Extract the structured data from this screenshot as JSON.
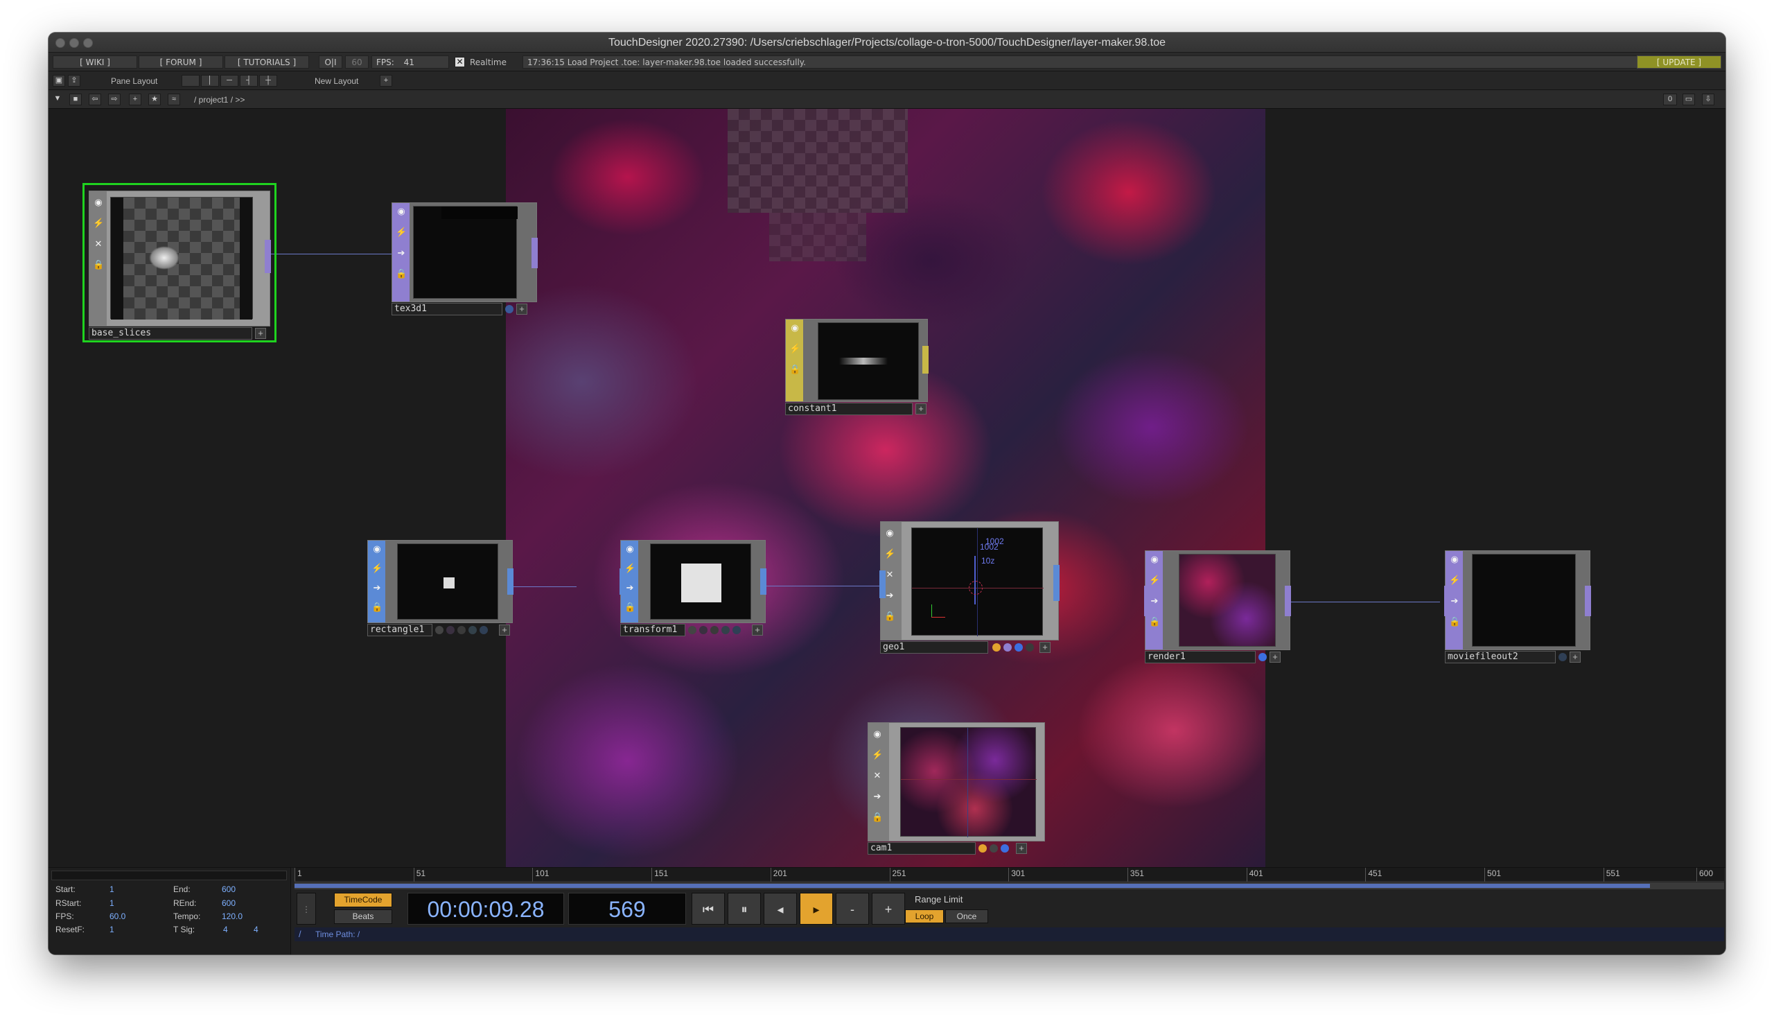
{
  "window": {
    "title": "TouchDesigner 2020.27390: /Users/criebschlager/Projects/collage-o-tron-5000/TouchDesigner/layer-maker.98.toe"
  },
  "menubar": {
    "wiki": "[ WIKI ]",
    "forum": "[ FORUM ]",
    "tutorials": "[ TUTORIALS ]",
    "oi": "O|I",
    "fps_cap": "60",
    "fps_label": "FPS:",
    "fps_value": "41",
    "realtime_label": "Realtime",
    "realtime_checked": true,
    "status_message": "17:36:15 Load Project .toe: layer-maker.98.toe loaded successfully.",
    "update": "[ UPDATE ]"
  },
  "pane_toolbar": {
    "pane_layout": "Pane Layout",
    "new_layout": "New Layout",
    "add": "+"
  },
  "path_bar": {
    "path": "/  project1  /  >>",
    "counter": "0"
  },
  "nodes": {
    "base_slices": {
      "name": "base_slices",
      "family": "COMP",
      "selected": true
    },
    "tex3d1": {
      "name": "tex3d1",
      "family": "TOP"
    },
    "constant1": {
      "name": "constant1",
      "family": "MAT"
    },
    "rectangle1": {
      "name": "rectangle1",
      "family": "SOP"
    },
    "transform1": {
      "name": "transform1",
      "family": "SOP"
    },
    "geo1": {
      "name": "geo1",
      "family": "COMP"
    },
    "render1": {
      "name": "render1",
      "family": "TOP"
    },
    "moviefileout2": {
      "name": "moviefileout2",
      "family": "TOP"
    },
    "cam1": {
      "name": "cam1",
      "family": "COMP"
    }
  },
  "geo_viewer": {
    "label1": "1002",
    "label2": "1002",
    "label3": "10z"
  },
  "colors": {
    "top": "#8f7fd0",
    "sop": "#5b8ad6",
    "mat": "#c8b847",
    "comp": "#9a9a9a",
    "selected": "#1fd31f",
    "accent_orange": "#e3a32e",
    "timecode_blue": "#8ab4ff"
  },
  "timeline": {
    "ruler_ticks": [
      "1",
      "51",
      "101",
      "151",
      "201",
      "251",
      "301",
      "351",
      "401",
      "451",
      "501",
      "551",
      "600"
    ],
    "progress_fraction": 0.948,
    "timecode_mode": "TimeCode",
    "beats_mode": "Beats",
    "timecode": "00:00:09.28",
    "frame": "569",
    "btn_rewind": "⏮",
    "btn_pause": "⏸",
    "btn_step_back": "◂",
    "btn_play": "▸",
    "btn_minus": "-",
    "btn_plus": "+",
    "range_limit": "Range Limit",
    "loop": "Loop",
    "once": "Once",
    "time_path_slash": "/",
    "time_path": "Time Path: /",
    "info": {
      "start_label": "Start:",
      "start": "1",
      "end_label": "End:",
      "end": "600",
      "rstart_label": "RStart:",
      "rstart": "1",
      "rend_label": "REnd:",
      "rend": "600",
      "fps_label": "FPS:",
      "fps": "60.0",
      "tempo_label": "Tempo:",
      "tempo": "120.0",
      "resetf_label": "ResetF:",
      "resetf": "1",
      "tsig_label": "T Sig:",
      "tsig_a": "4",
      "tsig_b": "4"
    }
  }
}
